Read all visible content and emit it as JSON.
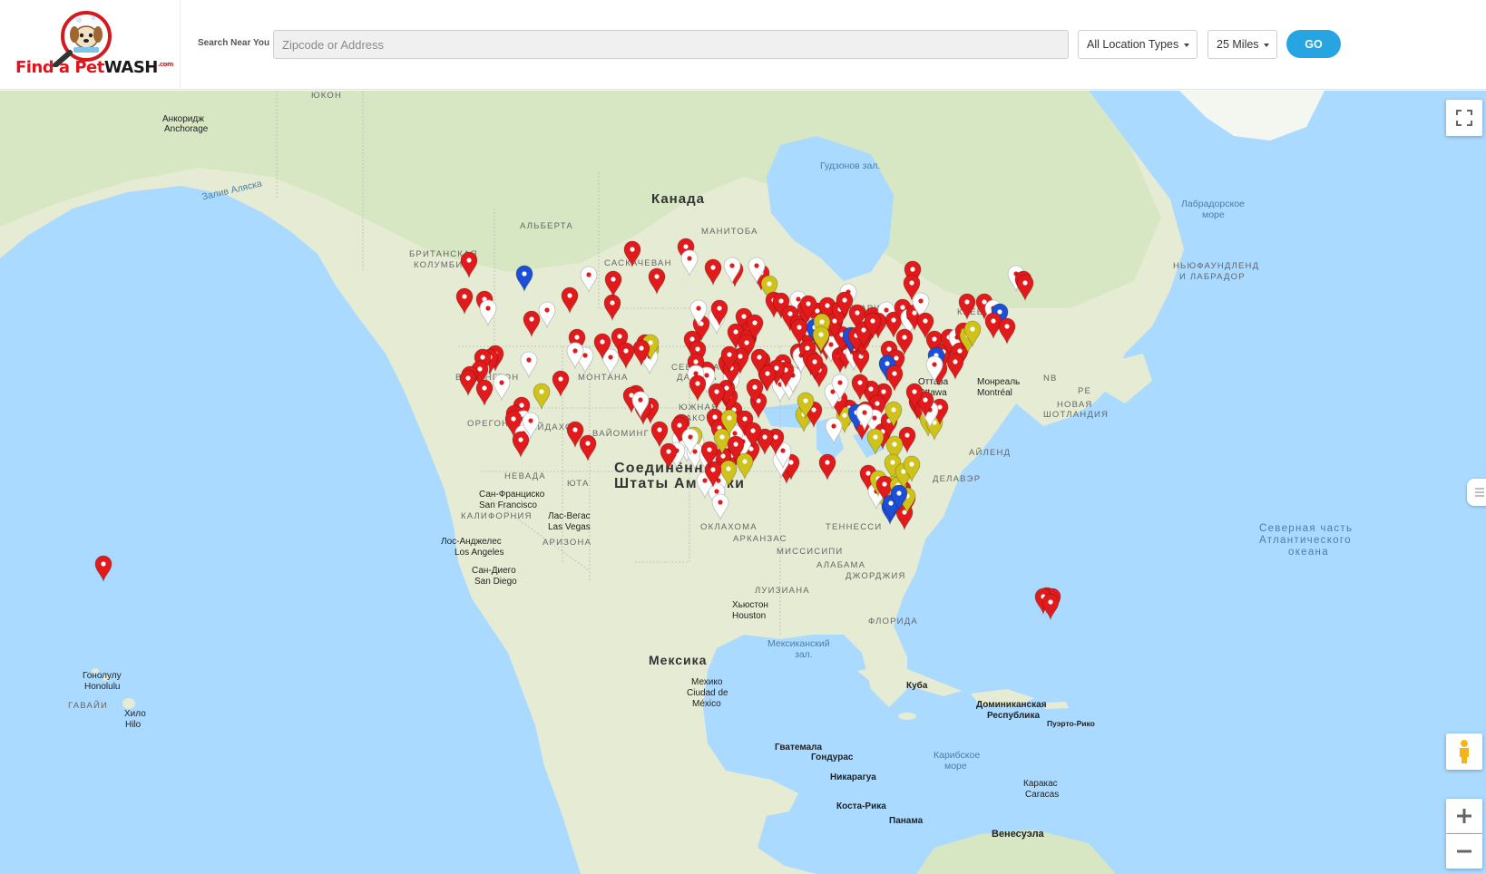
{
  "header": {
    "logo": {
      "find": "Find a Pet",
      "wash": "WASH",
      "com": ".com",
      "alt": "Find a Pet Wash"
    },
    "search_label": "Search Near You",
    "search_placeholder": "Zipcode or Address",
    "search_value": "",
    "location_type": {
      "selected": "All Location Types"
    },
    "distance": {
      "selected": "25 Miles"
    },
    "go_label": "GO"
  },
  "map": {
    "labels": {
      "yukon": "ЮКОН",
      "anchorage_ru": "Анкоридж",
      "anchorage_en": "Anchorage",
      "gulf_alaska": "Залив Аляска",
      "hudson_bay": "Гудзонов зал.",
      "canada": "Канада",
      "alberta": "АЛЬБЕРТА",
      "manitoba": "МАНИТОБА",
      "bc1": "БРИТАНСКАЯ",
      "bc2": "КОЛУМБИЯ",
      "saskatchewan": "САСКАЧЕВАН",
      "labrador_sea1": "Лабрадорское",
      "labrador_sea2": "море",
      "nfl1": "НЬЮФАУНДЛЕНД",
      "nfl2": "И ЛАБРАДОР",
      "quebec": "КВЕБЕК",
      "ontario": "ОНТАРИО",
      "washington": "ВАШИНГТОН",
      "montana": "МОНТАНА",
      "north_dakota1": "СЕВЕРНАЯ",
      "north_dakota2": "ДАКОТА",
      "ottawa1": "Оттава",
      "ottawa2": "Ottawa",
      "montreal1": "Монреаль",
      "montreal2": "Montréal",
      "nb": "NB",
      "pe": "PE",
      "nova_scotia1": "НОВАЯ",
      "nova_scotia2": "ШОТЛАНДИЯ",
      "oregon": "ОРЕГОН",
      "idaho": "АЙДАХО",
      "wyoming": "ВАЙОМИНГ",
      "south_dakota1": "ЮЖНАЯ",
      "south_dakota2": "ДАКОТА",
      "nevada": "НЕВАДА",
      "utah": "ЮТА",
      "us1": "Соединённые",
      "us2": "Штаты Америки",
      "rhode_island": "АЙЛЕНД",
      "delaware": "ДЕЛАВЭР",
      "sf1": "Сан-Франциско",
      "sf2": "San Francisco",
      "california": "КАЛИФОРНИЯ",
      "vegas1": "Лас-Вегас",
      "vegas2": "Las Vegas",
      "arizona": "АРИЗОНА",
      "oklahoma": "ОКЛАХОМА",
      "arkansas": "АРКАНЗАС",
      "tennessee": "ТЕННЕССИ",
      "mississippi": "МИССИСИПИ",
      "alabama": "АЛАБАМА",
      "georgia": "ДЖОРДЖИЯ",
      "louisiana": "ЛУИЗИАНА",
      "florida": "ФЛОРИДА",
      "la1": "Лос-Анджелес",
      "la2": "Los Angeles",
      "sd1": "Сан-Диего",
      "sd2": "San Diego",
      "houston1": "Хьюстон",
      "houston2": "Houston",
      "north_atlantic1": "Северная часть",
      "north_atlantic2": "Атлантического",
      "north_atlantic3": "океана",
      "gulf_mexico1": "Мексиканский",
      "gulf_mexico2": "зал.",
      "mexico": "Мексика",
      "mexico_city1": "Мехико",
      "mexico_city2": "Ciudad de",
      "mexico_city3": "México",
      "cuba": "Куба",
      "dr1": "Доминиканская",
      "dr2": "Республика",
      "pr": "Пуэрто-Рико",
      "honolulu1": "Гонолулу",
      "honolulu2": "Honolulu",
      "hawaii": "ГАВАЙИ",
      "hilo1": "Хило",
      "hilo2": "Hilo",
      "guatemala": "Гватемала",
      "honduras": "Гондурас",
      "caribbean1": "Карибское",
      "caribbean2": "море",
      "nicaragua": "Никарагуа",
      "caracas1": "Каракас",
      "caracas2": "Caracas",
      "costa_rica": "Коста-Рика",
      "panama": "Панама",
      "venezuela": "Венесуэла"
    },
    "pin_colors": {
      "red": "#e11b1b",
      "white": "#ffffff",
      "blue": "#1c4fd6",
      "yellow": "#cfc21a"
    },
    "land_color": "#e9efd8",
    "water_color": "#aadaff"
  }
}
